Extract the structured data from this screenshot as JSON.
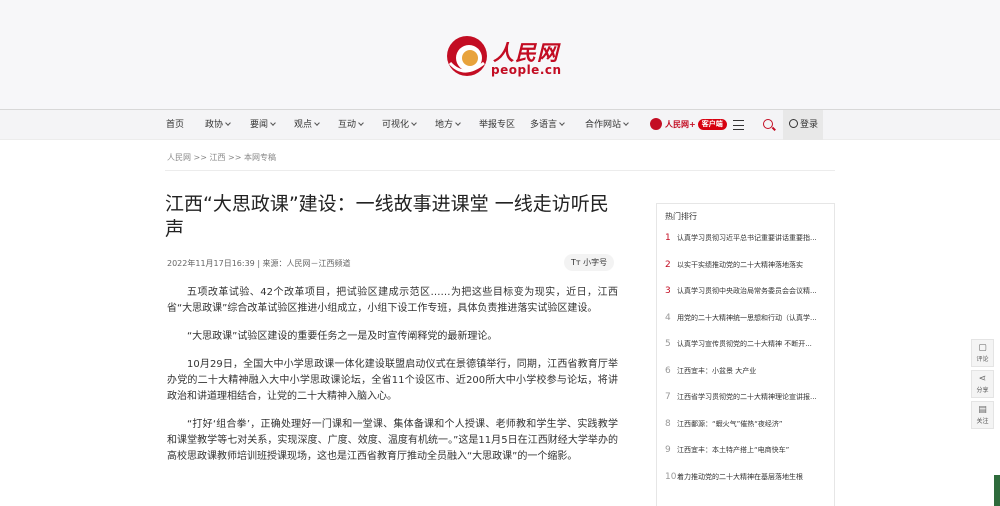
{
  "brand": {
    "name_cn": "人民网",
    "name_en": "people.cn",
    "color": "#c30d23"
  },
  "nav": {
    "items": [
      {
        "label": "首页",
        "dropdown": false
      },
      {
        "label": "政协",
        "dropdown": true
      },
      {
        "label": "要闻",
        "dropdown": true
      },
      {
        "label": "观点",
        "dropdown": true
      },
      {
        "label": "互动",
        "dropdown": true
      },
      {
        "label": "可视化",
        "dropdown": true
      },
      {
        "label": "地方",
        "dropdown": true
      },
      {
        "label": "举报专区",
        "dropdown": false
      },
      {
        "label": "多语言",
        "dropdown": true
      },
      {
        "label": "合作网站",
        "dropdown": true
      }
    ],
    "app_name": "人民网+",
    "app_badge": "客户端",
    "login_label": "登录"
  },
  "breadcrumb": "人民网 >> 江西 >> 本网专稿",
  "article": {
    "title": "江西“大思政课”建设：一线故事进课堂 一线走访听民声",
    "meta": "2022年11月17日16:39 | 来源：人民网－江西频道",
    "font_toggle": "小字号",
    "font_toggle_icon": "Tт",
    "paragraphs": [
      "五项改革试验、42个改革项目，把试验区建成示范区……为把这些目标变为现实，近日，江西省“大思政课”综合改革试验区推进小组成立，小组下设工作专班，具体负责推进落实试验区建设。",
      "“大思政课”试验区建设的重要任务之一是及时宣传阐释党的最新理论。",
      "10月29日，全国大中小学思政课一体化建设联盟启动仪式在景德镇举行，同期，江西省教育厅举办党的二十大精神融入大中小学思政课论坛，全省11个设区市、近200所大中小学校参与论坛，将讲政治和讲道理相结合，让党的二十大精神入脑入心。",
      "“打好‘组合拳’，正确处理好一门课和一堂课、集体备课和个人授课、老师教和学生学、实践教学和课堂教学等七对关系，实现深度、广度、效度、温度有机统一。”这是11月5日在江西财经大学举办的高校思政课教师培训班授课现场，这也是江西省教育厅推动全员融入“大思政课”的一个缩影。"
    ]
  },
  "hot": {
    "title": "热门排行",
    "items": [
      {
        "rank": "1",
        "text": "认真学习贯彻习近平总书记重要讲话重要指..."
      },
      {
        "rank": "2",
        "text": "以实干实绩推动党的二十大精神落地落实"
      },
      {
        "rank": "3",
        "text": "认真学习贯彻中央政治局常务委员会会议精..."
      },
      {
        "rank": "4",
        "text": "用党的二十大精神统一思想和行动（认真学..."
      },
      {
        "rank": "5",
        "text": "认真学习宣传贯彻党的二十大精神 不断开..."
      },
      {
        "rank": "6",
        "text": "江西宜丰：小盆景 大产业"
      },
      {
        "rank": "7",
        "text": "江西省学习贯彻党的二十大精神理论宣讲报..."
      },
      {
        "rank": "8",
        "text": "江西鄱源：“蝦火气”催热“夜经济”"
      },
      {
        "rank": "9",
        "text": "江西宜丰：本土特产搭上“电商快车”"
      },
      {
        "rank": "10",
        "text": "着力推动党的二十大精神在基层落地生根"
      }
    ]
  },
  "side_tools": [
    {
      "label": "评论",
      "icon": "comment-icon",
      "glyph": "💬"
    },
    {
      "label": "分享",
      "icon": "share-icon",
      "glyph": "⋖"
    },
    {
      "label": "关注",
      "icon": "follow-icon",
      "glyph": "▤"
    }
  ]
}
